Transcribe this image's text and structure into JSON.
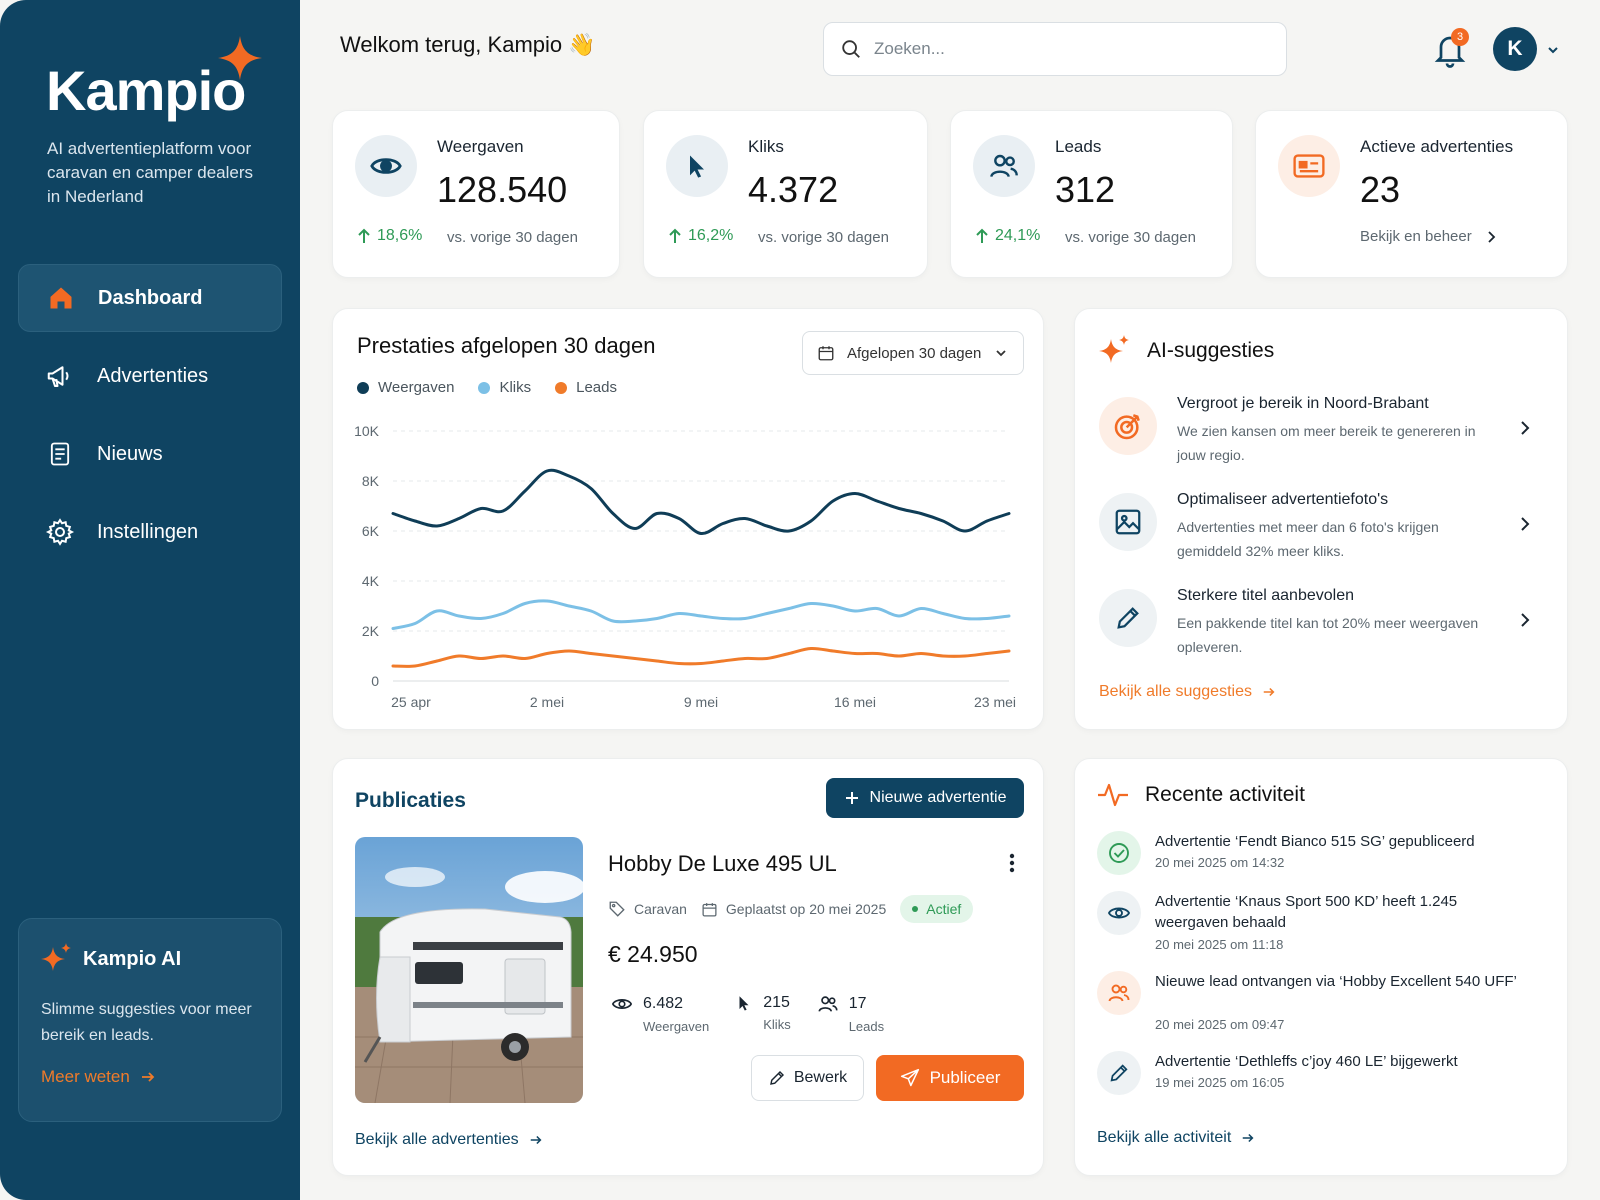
{
  "colors": {
    "brand": "#0f4462",
    "accent": "#f26a23",
    "positive": "#2e9a56"
  },
  "sidebar": {
    "logo": "Kampio",
    "tagline": "AI advertentieplatform voor caravan en camper dealers in Nederland",
    "items": [
      {
        "label": "Dashboard",
        "icon": "home-icon",
        "active": true
      },
      {
        "label": "Advertenties",
        "icon": "megaphone-icon",
        "active": false
      },
      {
        "label": "Nieuws",
        "icon": "document-icon",
        "active": false
      },
      {
        "label": "Instellingen",
        "icon": "gear-icon",
        "active": false
      }
    ],
    "ai_box": {
      "title": "Kampio AI",
      "text": "Slimme suggesties voor meer bereik en leads.",
      "link": "Meer weten"
    }
  },
  "header": {
    "welcome": "Welkom terug, Kampio 👋",
    "search_placeholder": "Zoeken...",
    "notification_count": "3",
    "avatar_initial": "K"
  },
  "stats": [
    {
      "title": "Weergaven",
      "value": "128.540",
      "delta": "18,6%",
      "compare": "vs. vorige 30 dagen",
      "icon": "eye-icon"
    },
    {
      "title": "Kliks",
      "value": "4.372",
      "delta": "16,2%",
      "compare": "vs. vorige 30 dagen",
      "icon": "cursor-icon"
    },
    {
      "title": "Leads",
      "value": "312",
      "delta": "24,1%",
      "compare": "vs. vorige 30 dagen",
      "icon": "users-icon"
    },
    {
      "title": "Actieve advertenties",
      "value": "23",
      "manage": "Bekijk en beheer",
      "icon": "ad-card-icon"
    }
  ],
  "performance": {
    "title": "Prestaties afgelopen 30 dagen",
    "range": "Afgelopen 30 dagen"
  },
  "chart_data": {
    "type": "line",
    "x": [
      "25 apr",
      "26 apr",
      "27 apr",
      "28 apr",
      "29 apr",
      "30 apr",
      "1 mei",
      "2 mei",
      "3 mei",
      "4 mei",
      "5 mei",
      "6 mei",
      "7 mei",
      "8 mei",
      "9 mei",
      "10 mei",
      "11 mei",
      "12 mei",
      "13 mei",
      "14 mei",
      "15 mei",
      "16 mei",
      "17 mei",
      "18 mei",
      "19 mei",
      "20 mei",
      "21 mei",
      "22 mei",
      "23 mei"
    ],
    "x_ticks": [
      "25 apr",
      "2 mei",
      "9 mei",
      "16 mei",
      "23 mei"
    ],
    "y_ticks": [
      "0",
      "2K",
      "4K",
      "6K",
      "8K",
      "10K"
    ],
    "ylim": [
      0,
      10000
    ],
    "grid": true,
    "legend": "top-left",
    "series": [
      {
        "name": "Weergaven",
        "color": "#0f3d57",
        "values": [
          6700,
          6400,
          6200,
          6500,
          6900,
          6800,
          7600,
          8400,
          8200,
          7700,
          6700,
          6100,
          6700,
          6500,
          5900,
          6300,
          6500,
          6200,
          6000,
          6400,
          7200,
          7500,
          7200,
          6900,
          6700,
          6400,
          6000,
          6400,
          6700
        ]
      },
      {
        "name": "Kliks",
        "color": "#7cc0e6",
        "values": [
          2100,
          2300,
          2800,
          2600,
          2500,
          2700,
          3100,
          3200,
          3000,
          2800,
          2400,
          2400,
          2500,
          2700,
          2600,
          2500,
          2500,
          2700,
          2900,
          3100,
          3000,
          2800,
          2900,
          2600,
          2900,
          2700,
          2500,
          2500,
          2600
        ]
      },
      {
        "name": "Leads",
        "color": "#f07b2a",
        "values": [
          600,
          600,
          800,
          1000,
          900,
          1000,
          900,
          1100,
          1200,
          1100,
          1000,
          900,
          800,
          700,
          700,
          800,
          900,
          900,
          1100,
          1300,
          1200,
          1100,
          1100,
          1000,
          1100,
          1000,
          1000,
          1100,
          1200
        ]
      }
    ]
  },
  "suggestions": {
    "title": "AI-suggesties",
    "items": [
      {
        "title": "Vergroot je bereik in Noord-Brabant",
        "desc": "We zien kansen om meer bereik te genereren in jouw regio.",
        "icon": "target-icon"
      },
      {
        "title": "Optimaliseer advertentiefoto's",
        "desc": "Advertenties met meer dan 6 foto's krijgen gemiddeld 32% meer kliks.",
        "icon": "image-icon"
      },
      {
        "title": "Sterkere titel aanbevolen",
        "desc": "Een pakkende titel kan tot 20% meer weergaven opleveren.",
        "icon": "pencil-icon"
      }
    ],
    "link": "Bekijk alle suggesties"
  },
  "publications": {
    "title": "Publicaties",
    "new_button": "Nieuwe advertentie",
    "item": {
      "name": "Hobby De Luxe 495 UL",
      "category": "Caravan",
      "placed": "Geplaatst op 20 mei 2025",
      "status": "Actief",
      "price": "€ 24.950",
      "stats": [
        {
          "value": "6.482",
          "label": "Weergaven",
          "icon": "eye-icon"
        },
        {
          "value": "215",
          "label": "Kliks",
          "icon": "cursor-icon"
        },
        {
          "value": "17",
          "label": "Leads",
          "icon": "users-icon"
        }
      ],
      "edit_button": "Bewerk",
      "publish_button": "Publiceer"
    },
    "link": "Bekijk alle advertenties"
  },
  "activity": {
    "title": "Recente activiteit",
    "items": [
      {
        "text": "Advertentie ‘Fendt Bianco 515 SG’ gepubliceerd",
        "time": "20 mei 2025 om 14:32",
        "icon": "check-circle-icon"
      },
      {
        "text": "Advertentie ‘Knaus Sport 500 KD’ heeft 1.245 weergaven behaald",
        "time": "20 mei 2025 om 11:18",
        "icon": "eye-icon"
      },
      {
        "text": "Nieuwe lead ontvangen via ‘Hobby Excellent 540 UFF’",
        "time": "20 mei 2025 om 09:47",
        "icon": "users-icon"
      },
      {
        "text": "Advertentie ‘Dethleffs c’joy 460 LE’ bijgewerkt",
        "time": "19 mei 2025 om 16:05",
        "icon": "pencil-icon"
      }
    ],
    "link": "Bekijk alle activiteit"
  }
}
